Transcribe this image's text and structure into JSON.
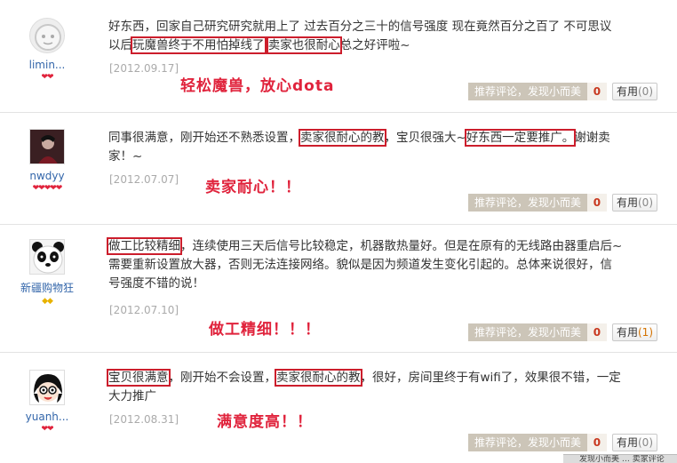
{
  "reviews": [
    {
      "user": "limin...",
      "rank": "❤❤",
      "text_a": "好东西，回家自己研究研究就用上了 过去百分之三十的信号强度 现在竟然百分之百了 不可思议 以后",
      "hl_1": "玩魔兽终于不用怕掉线了",
      "text_b": " ",
      "hl_2": "卖家也很耐心",
      "text_c": "总之好评啦~",
      "date": "[2012.09.17]",
      "note": "轻松魔兽，放心dota",
      "rec_label": "推荐评论，发现小而美",
      "rec_count": "0",
      "useful_label": "有用",
      "useful_count": "(0)"
    },
    {
      "user": "nwdyy",
      "rank": "❤❤❤❤❤",
      "text_a": "同事很满意，刚开始还不熟悉设置，",
      "hl_1": "卖家很耐心的教",
      "text_b": "，宝贝很强大~",
      "hl_2": "好东西一定要推广。",
      "text_c": "谢谢卖家！~",
      "date": "[2012.07.07]",
      "note": "卖家耐心！！",
      "rec_label": "推荐评论，发现小而美",
      "rec_count": "0",
      "useful_label": "有用",
      "useful_count": "(0)"
    },
    {
      "user": "新疆购物狂",
      "rank": "◆◆",
      "hl_1": "做工比较精细",
      "text_b": "，连续使用三天后信号比较稳定，机器散热量好。但是在原有的无线路由器重启后~需要重新设置放大器，否则无法连接网络。貌似是因为频道发生变化引起的。总体来说很好，信号强度不错的说！",
      "date": "[2012.07.10]",
      "note": "做工精细！！！",
      "rec_label": "推荐评论，发现小而美",
      "rec_count": "0",
      "useful_label": "有用",
      "useful_count": "(1)"
    },
    {
      "user": "yuanh...",
      "rank": "❤❤",
      "hl_1": "宝贝很满意",
      "text_b": "，刚开始不会设置，",
      "hl_2": "卖家很耐心的教",
      "text_c": "，很好，房间里终于有wifi了，效果很不错，一定大力推广",
      "date": "[2012.08.31]",
      "note": "满意度高！！",
      "rec_label": "推荐评论，发现小而美",
      "rec_count": "0",
      "useful_label": "有用",
      "useful_count": "(0)"
    }
  ],
  "corner_text": "发现小而美 … 卖家评论",
  "colors": {
    "annotation_red": "#e0233c",
    "username_blue": "#3366aa",
    "recommend_bg": "#ccc5b8"
  }
}
